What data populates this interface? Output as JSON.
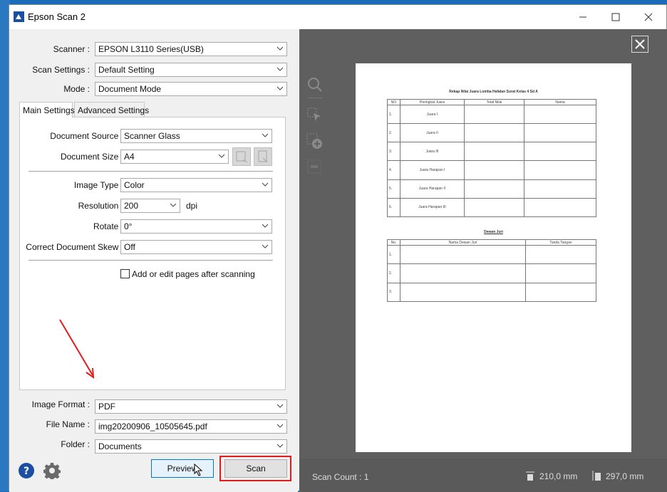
{
  "window": {
    "title": "Epson Scan 2"
  },
  "form": {
    "scanner": {
      "label": "Scanner :",
      "value": "EPSON L3110 Series(USB)"
    },
    "scan_settings": {
      "label": "Scan Settings :",
      "value": "Default Setting"
    },
    "mode": {
      "label": "Mode :",
      "value": "Document Mode"
    }
  },
  "tabs": [
    "Main Settings",
    "Advanced Settings"
  ],
  "main": {
    "document_source": {
      "label": "Document Source :",
      "value": "Scanner Glass"
    },
    "document_size": {
      "label": "Document Size :",
      "value": "A4"
    },
    "image_type": {
      "label": "Image Type :",
      "value": "Color"
    },
    "resolution": {
      "label": "Resolution :",
      "value": "200",
      "unit": "dpi"
    },
    "rotate": {
      "label": "Rotate :",
      "value": "0°"
    },
    "skew": {
      "label": "Correct Document Skew :",
      "value": "Off"
    },
    "add_pages": {
      "label": "Add or edit pages after scanning",
      "checked": false
    }
  },
  "output": {
    "image_format": {
      "label": "Image Format :",
      "value": "PDF"
    },
    "file_name": {
      "label": "File Name :",
      "value": "img20200906_10505645.pdf"
    },
    "folder": {
      "label": "Folder :",
      "value": "Documents"
    }
  },
  "buttons": {
    "preview": "Preview",
    "scan": "Scan"
  },
  "status": {
    "scan_count": "Scan Count : 1",
    "width": "210,0 mm",
    "height": "297,0 mm"
  },
  "document": {
    "title1": "Rekap Nilai Juara Lomba Hafalan Surat Kelas 4 Sd A",
    "table1_headers": [
      "NO",
      "Peringkat Juara",
      "Total Nilai",
      "Nama"
    ],
    "table1_rows": [
      [
        "1.",
        "Juara I"
      ],
      [
        "2.",
        "Juara II"
      ],
      [
        "3.",
        "Juara III"
      ],
      [
        "4.",
        "Juara Harapan I"
      ],
      [
        "5.",
        "Juara Harapan II"
      ],
      [
        "6.",
        "Juara Harapan III"
      ]
    ],
    "title2": "Dewan Juri",
    "table2_headers": [
      "No.",
      "Nama Dewan Juri",
      "Tanda Tangan"
    ],
    "table2_rows": [
      "1.",
      "2.",
      "3."
    ]
  },
  "colors": {
    "accent": "#0078d7",
    "highlight": "#e41b1b",
    "preview_bg": "#5f5f5f"
  }
}
